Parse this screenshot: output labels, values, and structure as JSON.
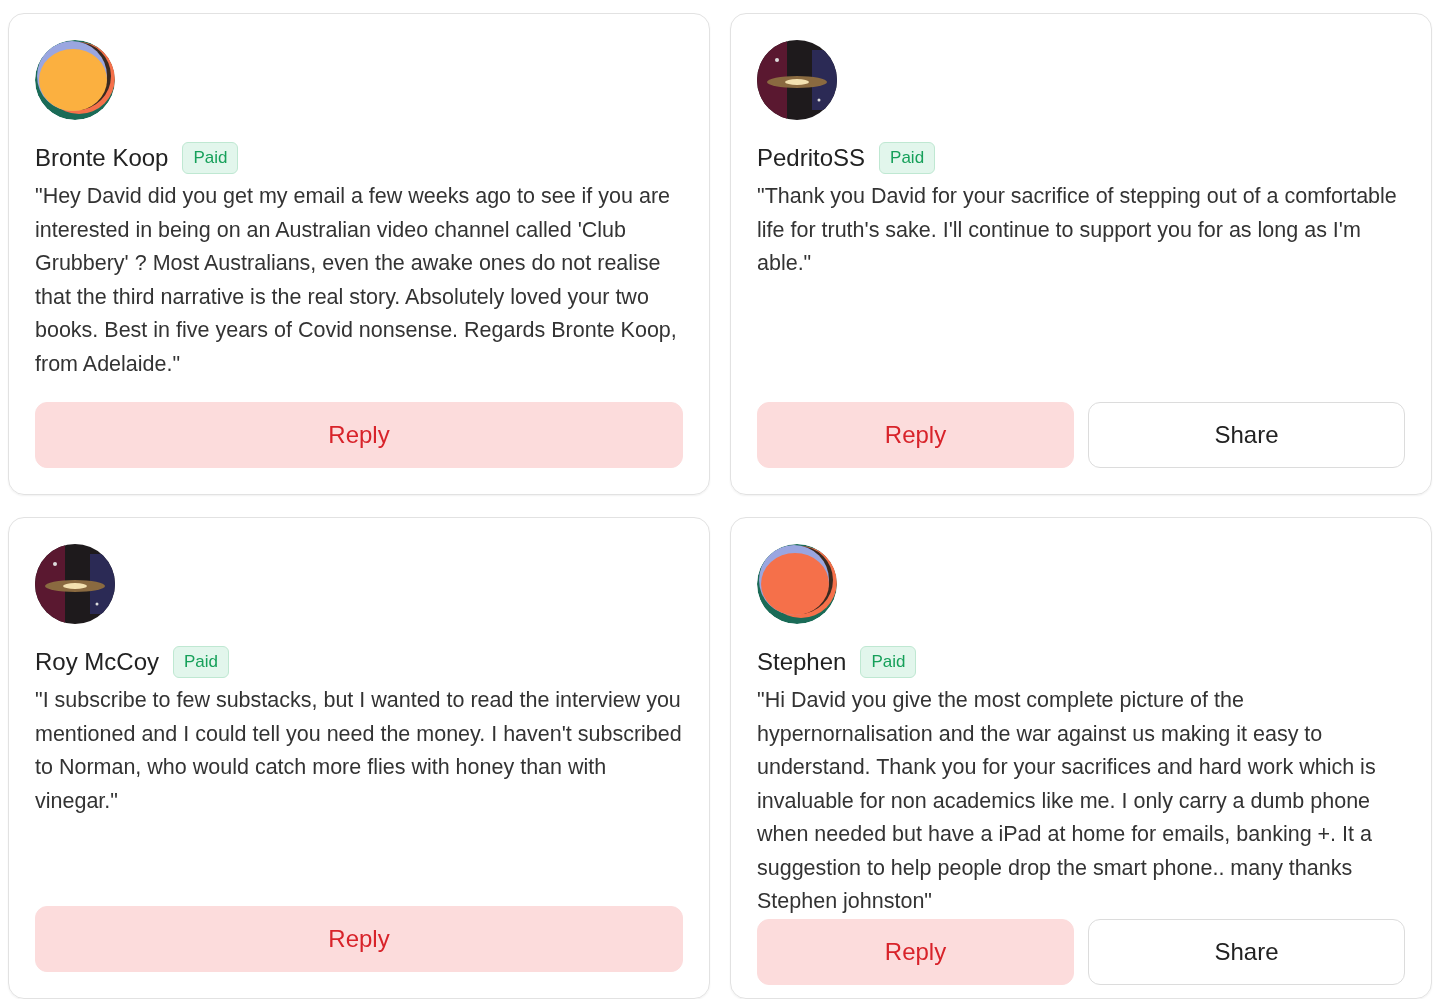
{
  "comments": [
    {
      "avatar": {
        "kind": "pattern",
        "color": "#fbb040"
      },
      "name": "Bronte Koop",
      "badge": "Paid",
      "text": "\"Hey David did you get my email a few weeks ago to see if you are interested in being on an Australian video channel called 'Club Grubbery' ? Most Australians, even the awake ones do not realise that the third narrative is the real story. Absolutely loved your two books. Best in five years of Covid nonsense. Regards Bronte Koop, from Adelaide.\"",
      "buttons": [
        {
          "label": "Reply",
          "kind": "reply"
        }
      ]
    },
    {
      "avatar": {
        "kind": "picture"
      },
      "name": "PedritoSS",
      "badge": "Paid",
      "text": "\"Thank you David for your sacrifice of stepping out of a comfortable life for truth's sake. I'll continue to support you for as long as I'm able.\"",
      "buttons": [
        {
          "label": "Reply",
          "kind": "reply"
        },
        {
          "label": "Share",
          "kind": "share"
        }
      ]
    },
    {
      "avatar": {
        "kind": "picture"
      },
      "name": "Roy McCoy",
      "badge": "Paid",
      "text": "\"I subscribe to few substacks, but I wanted to read the interview you mentioned and I could tell you need the money. I haven't subscribed to Norman, who would catch more flies with honey than with vinegar.\"",
      "buttons": [
        {
          "label": "Reply",
          "kind": "reply"
        }
      ]
    },
    {
      "avatar": {
        "kind": "pattern",
        "color": "#f5704a"
      },
      "name": "Stephen",
      "badge": "Paid",
      "text": "\"Hi David you give the most complete picture of the hypernornalisation and the war against us making it easy to understand. Thank you for your sacrifices and hard work which is invaluable for non academics like me. I only carry a dumb phone when needed but have a iPad at home for emails, banking +. It a suggestion to help people drop the smart phone.. many thanks Stephen johnston\"",
      "buttons": [
        {
          "label": "Reply",
          "kind": "reply"
        },
        {
          "label": "Share",
          "kind": "share"
        }
      ]
    }
  ]
}
